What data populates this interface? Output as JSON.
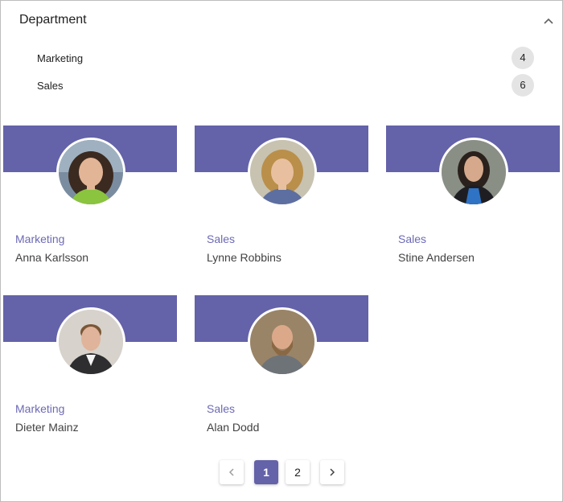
{
  "facet": {
    "title": "Department",
    "toggle_icon": "chevron-up-icon",
    "items": [
      {
        "label": "Marketing",
        "count": "4"
      },
      {
        "label": "Sales",
        "count": "6"
      }
    ]
  },
  "theme": {
    "accent": "#6462a8",
    "dept_text": "#6c6ab5",
    "badge_bg": "#e4e4e4"
  },
  "cards": [
    {
      "department": "Marketing",
      "name": "Anna Karlsson",
      "avatar": "person-photo"
    },
    {
      "department": "Sales",
      "name": "Lynne Robbins",
      "avatar": "person-photo"
    },
    {
      "department": "Sales",
      "name": "Stine Andersen",
      "avatar": "person-photo"
    },
    {
      "department": "Marketing",
      "name": "Dieter Mainz",
      "avatar": "person-photo"
    },
    {
      "department": "Sales",
      "name": "Alan Dodd",
      "avatar": "person-photo"
    }
  ],
  "pagination": {
    "prev_icon": "chevron-left-icon",
    "next_icon": "chevron-right-icon",
    "pages": [
      "1",
      "2"
    ],
    "current": "1"
  }
}
